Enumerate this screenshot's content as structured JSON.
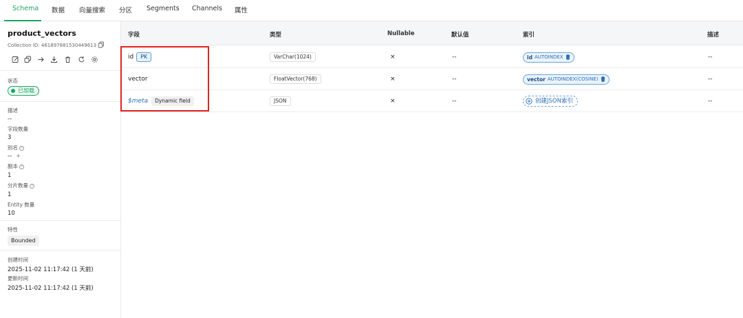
{
  "tabs": [
    {
      "label": "Schema",
      "active": true
    },
    {
      "label": "数据"
    },
    {
      "label": "向量搜索"
    },
    {
      "label": "分区"
    },
    {
      "label": "Segments"
    },
    {
      "label": "Channels"
    },
    {
      "label": "属性"
    }
  ],
  "sidebar": {
    "collection_name": "product_vectors",
    "collection_id": "Collection ID: 461897881530449613",
    "status_label": "状态",
    "status_value": "已加载",
    "description_label": "描述",
    "description_value": "--",
    "field_count_label": "字段数量",
    "field_count_value": "3",
    "alias_label": "别名",
    "alias_value": "--",
    "alias_add": "+",
    "replica_label": "副本",
    "replica_value": "1",
    "shard_label": "分片数量",
    "shard_value": "1",
    "entity_label": "Entity 数量",
    "entity_value": "10",
    "feature_label": "特性",
    "feature_value": "Bounded",
    "created_label": "创建时间",
    "created_value": "2025-11-02 11:17:42 (1 天前)",
    "updated_label": "更新时间",
    "updated_value": "2025-11-02 11:17:42 (1 天前)",
    "help_glyph": "?"
  },
  "table": {
    "headers": {
      "field": "字段",
      "type": "类型",
      "nullable": "Nullable",
      "default": "默认值",
      "index": "索引",
      "description": "描述"
    },
    "rows": [
      {
        "name": "id",
        "badge": "PK",
        "type": "VarChar(1024)",
        "nullable": "×",
        "default": "--",
        "index_field": "id",
        "index_type": "AUTOINDEX",
        "description": "--"
      },
      {
        "name": "vector",
        "type": "FloatVector(768)",
        "nullable": "×",
        "default": "--",
        "index_field": "vector",
        "index_type": "AUTOINDEX(COSINE)",
        "description": "--"
      },
      {
        "name": "$meta",
        "badge": "Dynamic field",
        "type": "JSON",
        "nullable": "×",
        "default": "--",
        "index_action": "创建JSON索引",
        "description": "--"
      }
    ]
  },
  "colors": {
    "accent": "#1ea363",
    "link": "#2c6fb7",
    "highlight": "#e02020"
  },
  "icons": [
    "copy-icon",
    "edit-icon",
    "duplicate-icon",
    "arrow-right-icon",
    "download-icon",
    "trash-icon",
    "refresh-icon",
    "gear-icon",
    "plus-circle-icon"
  ]
}
